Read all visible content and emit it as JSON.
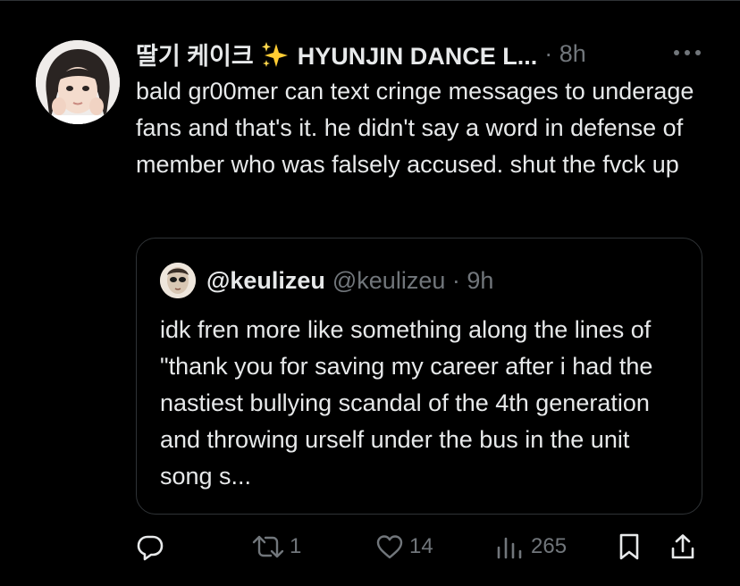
{
  "tweet": {
    "author": {
      "display_name": "딸기 케이크",
      "display_name_suffix": "HYUNJIN DANCE L...",
      "time": "8h",
      "separator": "·"
    },
    "text": "bald gr00mer can text cringe messages to underage fans and that's it. he didn't say a word in defense of member who was falsely accused. shut the fvck up"
  },
  "quote": {
    "display_name": "@keulizeu",
    "handle": "@keulizeu",
    "separator": "·",
    "time": "9h",
    "text": "idk fren more like something along the lines of \"thank you for saving my career after i had the nastiest bullying scandal of the 4th generation and throwing urself under the bus in the unit song s..."
  },
  "actions": {
    "reply_count": "",
    "retweet_count": "1",
    "like_count": "14",
    "views_count": "265"
  },
  "icons": [
    "sparkles-icon",
    "more-icon",
    "reply-icon",
    "retweet-icon",
    "like-icon",
    "views-icon",
    "bookmark-icon",
    "share-icon"
  ],
  "colors": {
    "background": "#000000",
    "text": "#e7e9ea",
    "secondary_text": "#71767b",
    "border": "#2f3336"
  }
}
